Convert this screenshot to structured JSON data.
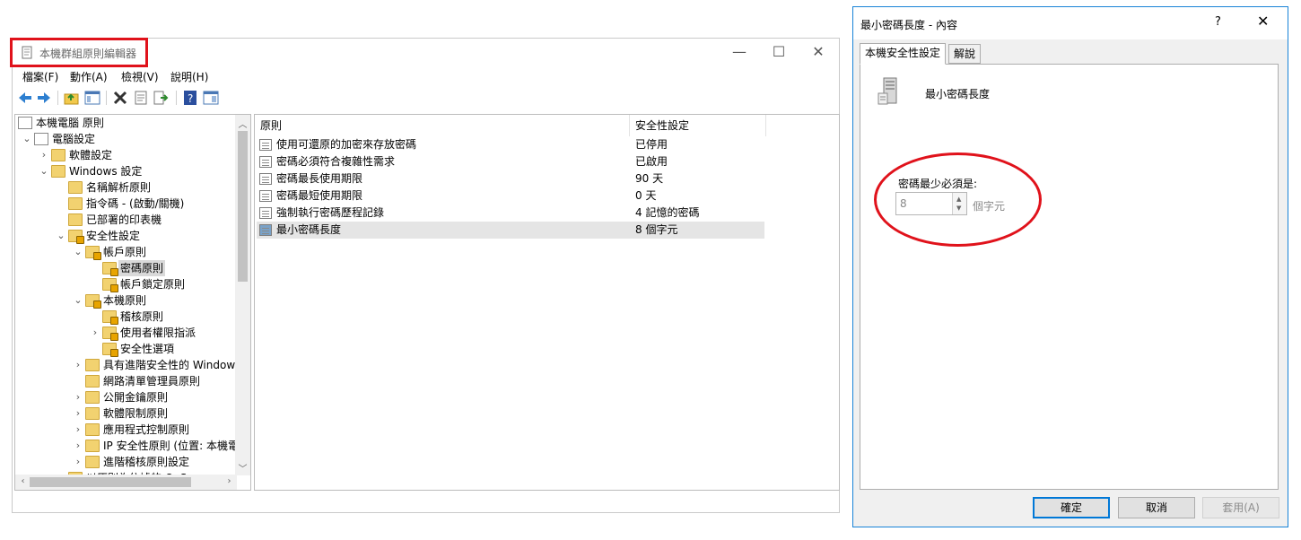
{
  "main_window": {
    "title": "本機群組原則編輯器",
    "menu": [
      "檔案(F)",
      "動作(A)",
      "檢視(V)",
      "說明(H)"
    ],
    "window_controls": {
      "minimize": "—",
      "maximize": "☐",
      "close": "✕"
    }
  },
  "tree": {
    "root": "本機電腦 原則",
    "items": [
      {
        "label": "電腦設定",
        "level": 1,
        "twisty": "⌄"
      },
      {
        "label": "軟體設定",
        "level": 2,
        "twisty": "›"
      },
      {
        "label": "Windows 設定",
        "level": 2,
        "twisty": "⌄"
      },
      {
        "label": "名稱解析原則",
        "level": 3,
        "twisty": ""
      },
      {
        "label": "指令碼 - (啟動/關機)",
        "level": 3,
        "twisty": ""
      },
      {
        "label": "已部署的印表機",
        "level": 3,
        "twisty": ""
      },
      {
        "label": "安全性設定",
        "level": 3,
        "twisty": "⌄"
      },
      {
        "label": "帳戶原則",
        "level": 4,
        "twisty": "⌄"
      },
      {
        "label": "密碼原則",
        "level": 5,
        "twisty": ""
      },
      {
        "label": "帳戶鎖定原則",
        "level": 5,
        "twisty": ""
      },
      {
        "label": "本機原則",
        "level": 4,
        "twisty": "⌄"
      },
      {
        "label": "稽核原則",
        "level": 5,
        "twisty": ""
      },
      {
        "label": "使用者權限指派",
        "level": 5,
        "twisty": "›"
      },
      {
        "label": "安全性選項",
        "level": 5,
        "twisty": ""
      },
      {
        "label": "具有進階安全性的 Window",
        "level": 4,
        "twisty": "›"
      },
      {
        "label": "網路清單管理員原則",
        "level": 4,
        "twisty": ""
      },
      {
        "label": "公開金鑰原則",
        "level": 4,
        "twisty": "›"
      },
      {
        "label": "軟體限制原則",
        "level": 4,
        "twisty": "›"
      },
      {
        "label": "應用程式控制原則",
        "level": 4,
        "twisty": "›"
      },
      {
        "label": "IP 安全性原則 (位置: 本機電",
        "level": 4,
        "twisty": "›"
      },
      {
        "label": "進階稽核原則設定",
        "level": 4,
        "twisty": "›"
      },
      {
        "label": "以原則為依據的 QoS",
        "level": 3,
        "twisty": "›"
      }
    ]
  },
  "list": {
    "headers": {
      "policy": "原則",
      "setting": "安全性設定"
    },
    "rows": [
      {
        "name": "使用可還原的加密來存放密碼",
        "value": "已停用"
      },
      {
        "name": "密碼必須符合複雜性需求",
        "value": "已啟用"
      },
      {
        "name": "密碼最長使用期限",
        "value": "90 天"
      },
      {
        "name": "密碼最短使用期限",
        "value": "0 天"
      },
      {
        "name": "強制執行密碼歷程記錄",
        "value": "4 記憶的密碼"
      },
      {
        "name": "最小密碼長度",
        "value": "8 個字元"
      }
    ]
  },
  "dialog": {
    "title": "最小密碼長度 - 內容",
    "help": "?",
    "close": "✕",
    "tabs": [
      "本機安全性設定",
      "解說"
    ],
    "policy_name": "最小密碼長度",
    "min_label": "密碼最少必須是:",
    "min_value": "8",
    "unit": "個字元",
    "buttons": {
      "ok": "確定",
      "cancel": "取消",
      "apply": "套用(A)"
    }
  }
}
